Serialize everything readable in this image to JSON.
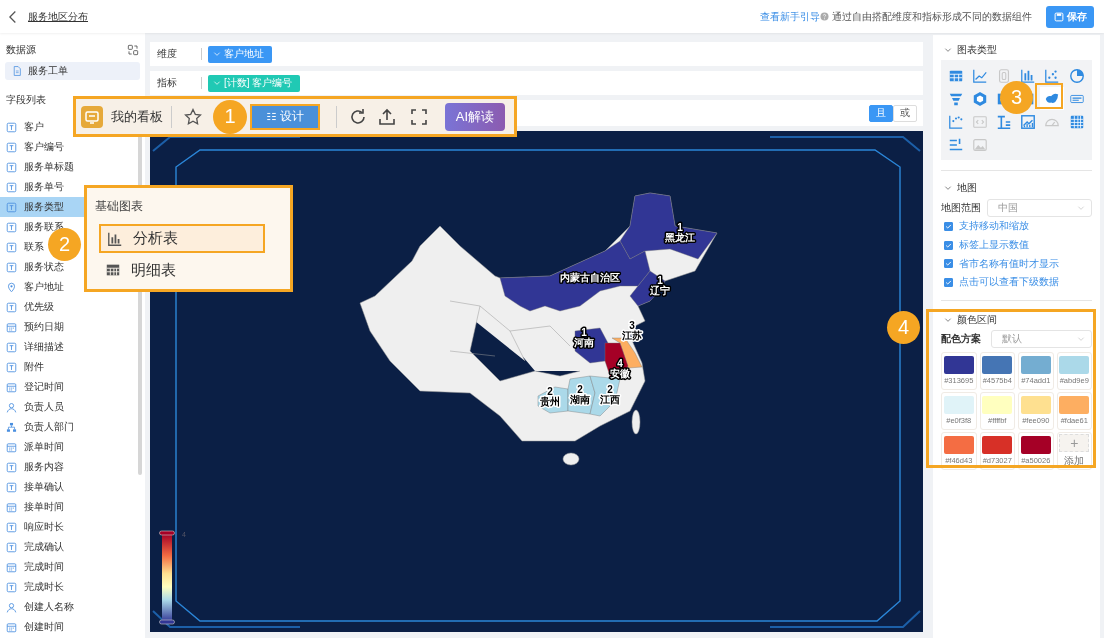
{
  "header": {
    "title": "服务地区分布",
    "guide_link": "查看新手引导",
    "hint": "通过自由搭配维度和指标形成不同的数据组件",
    "save_button": "保存"
  },
  "sidebar": {
    "datasource_title": "数据源",
    "datasource": "服务工单",
    "fields_title": "字段列表",
    "fields": [
      {
        "label": "客户",
        "kind": "text",
        "selected": false
      },
      {
        "label": "客户编号",
        "kind": "text",
        "selected": false
      },
      {
        "label": "服务单标题",
        "kind": "text",
        "selected": false
      },
      {
        "label": "服务单号",
        "kind": "text",
        "selected": false
      },
      {
        "label": "服务类型",
        "kind": "text",
        "selected": true
      },
      {
        "label": "服务联系",
        "kind": "text",
        "selected": false
      },
      {
        "label": "联系",
        "kind": "text",
        "selected": false
      },
      {
        "label": "服务状态",
        "kind": "text",
        "selected": false
      },
      {
        "label": "客户地址",
        "kind": "location",
        "selected": false
      },
      {
        "label": "优先级",
        "kind": "text",
        "selected": false
      },
      {
        "label": "预约日期",
        "kind": "date",
        "selected": false
      },
      {
        "label": "详细描述",
        "kind": "text",
        "selected": false
      },
      {
        "label": "附件",
        "kind": "text",
        "selected": false
      },
      {
        "label": "登记时间",
        "kind": "date",
        "selected": false
      },
      {
        "label": "负责人员",
        "kind": "person",
        "selected": false
      },
      {
        "label": "负责人部门",
        "kind": "org",
        "selected": false
      },
      {
        "label": "派单时间",
        "kind": "date",
        "selected": false
      },
      {
        "label": "服务内容",
        "kind": "text",
        "selected": false
      },
      {
        "label": "接单确认",
        "kind": "text",
        "selected": false
      },
      {
        "label": "接单时间",
        "kind": "date",
        "selected": false
      },
      {
        "label": "响应时长",
        "kind": "text",
        "selected": false
      },
      {
        "label": "完成确认",
        "kind": "text",
        "selected": false
      },
      {
        "label": "完成时间",
        "kind": "date",
        "selected": false
      },
      {
        "label": "完成时长",
        "kind": "text",
        "selected": false
      },
      {
        "label": "创建人名称",
        "kind": "person",
        "selected": false
      },
      {
        "label": "创建时间",
        "kind": "date",
        "selected": false
      }
    ]
  },
  "builder": {
    "rows": [
      {
        "label": "维度",
        "chip": "客户地址",
        "kind": "dimension"
      },
      {
        "label": "指标",
        "chip": "[计数] 客户编号",
        "kind": "measure"
      }
    ],
    "logic_toggle": [
      {
        "label": "且",
        "selected": true
      },
      {
        "label": "或",
        "selected": false
      }
    ]
  },
  "map": {
    "regions": [
      {
        "name": "黑龙江",
        "value": "1",
        "color": "#313695"
      },
      {
        "name": "内蒙古自治区",
        "color": "#313695"
      },
      {
        "name": "辽宁",
        "value": "1",
        "color": "#313695"
      },
      {
        "name": "河南",
        "value": "1",
        "color": "#313695"
      },
      {
        "name": "江苏",
        "value": "3",
        "color": "#fdae61"
      },
      {
        "name": "安徽",
        "value": "4",
        "color": "#a50026"
      },
      {
        "name": "贵州",
        "value": "2",
        "color": "#abd9e9"
      },
      {
        "name": "湖南",
        "value": "2",
        "color": "#abd9e9"
      },
      {
        "name": "江西",
        "value": "2",
        "color": "#abd9e9"
      }
    ],
    "legend_max": "4"
  },
  "settings": {
    "chart_type_title": "图表类型",
    "chart_types": [
      {
        "kind": "table",
        "selected": false,
        "disabled": false
      },
      {
        "kind": "line-chart",
        "selected": false,
        "disabled": false
      },
      {
        "kind": "number-card",
        "selected": false,
        "disabled": true
      },
      {
        "kind": "bar-chart",
        "selected": false,
        "disabled": false
      },
      {
        "kind": "scatter-chart",
        "selected": false,
        "disabled": false
      },
      {
        "kind": "pie-chart",
        "selected": false,
        "disabled": false
      },
      {
        "kind": "funnel",
        "selected": false,
        "disabled": false
      },
      {
        "kind": "cube",
        "selected": false,
        "disabled": false
      },
      {
        "kind": "card",
        "selected": false,
        "disabled": false
      },
      {
        "kind": "column",
        "selected": false,
        "disabled": false
      },
      {
        "kind": "map",
        "selected": true,
        "disabled": false
      },
      {
        "kind": "text",
        "selected": false,
        "disabled": false
      },
      {
        "kind": "step-chart",
        "selected": false,
        "disabled": false
      },
      {
        "kind": "code",
        "selected": false,
        "disabled": true
      },
      {
        "kind": "text-list",
        "selected": false,
        "disabled": false
      },
      {
        "kind": "image-chart",
        "selected": false,
        "disabled": false
      },
      {
        "kind": "gauge",
        "selected": false,
        "disabled": true
      },
      {
        "kind": "grid-table",
        "selected": false,
        "disabled": false
      },
      {
        "kind": "ranking-list",
        "selected": false,
        "disabled": false
      },
      {
        "kind": "image",
        "selected": false,
        "disabled": true
      }
    ],
    "map_title": "地图",
    "range_label": "地图范围",
    "range_value": "中国",
    "options": [
      {
        "label": "支持移动和缩放",
        "checked": true
      },
      {
        "label": "标签上显示数值",
        "checked": true
      },
      {
        "label": "省市名称有值时才显示",
        "checked": true
      },
      {
        "label": "点击可以查看下级数据",
        "checked": true
      }
    ],
    "color_title": "颜色区间",
    "scheme_label": "配色方案",
    "scheme_value": "默认",
    "swatches": [
      {
        "color": "#313695",
        "label": "#313695"
      },
      {
        "color": "#4575b4",
        "label": "#4575b4"
      },
      {
        "color": "#74add1",
        "label": "#74add1"
      },
      {
        "color": "#abd9e9",
        "label": "#abd9e9"
      },
      {
        "color": "#e0f3f8",
        "label": "#e0f3f8"
      },
      {
        "color": "#ffffbf",
        "label": "#ffffbf"
      },
      {
        "color": "#fee090",
        "label": "#fee090"
      },
      {
        "color": "#fdae61",
        "label": "#fdae61"
      },
      {
        "color": "#f46d43",
        "label": "#f46d43"
      },
      {
        "color": "#d73027",
        "label": "#d73027"
      },
      {
        "color": "#a50026",
        "label": "#a50026"
      }
    ],
    "add_icon": "+",
    "add_label": "添加"
  },
  "overlay_toolbar": {
    "title": "我的看板",
    "badge": "1",
    "design_button": "设计",
    "ai_button": "AI解读"
  },
  "overlay_menu": {
    "title": "基础图表",
    "items": [
      {
        "label": "分析表",
        "kind": "bar",
        "selected": true
      },
      {
        "label": "明细表",
        "kind": "table",
        "selected": false
      }
    ]
  },
  "callouts": [
    "2",
    "3",
    "4"
  ]
}
